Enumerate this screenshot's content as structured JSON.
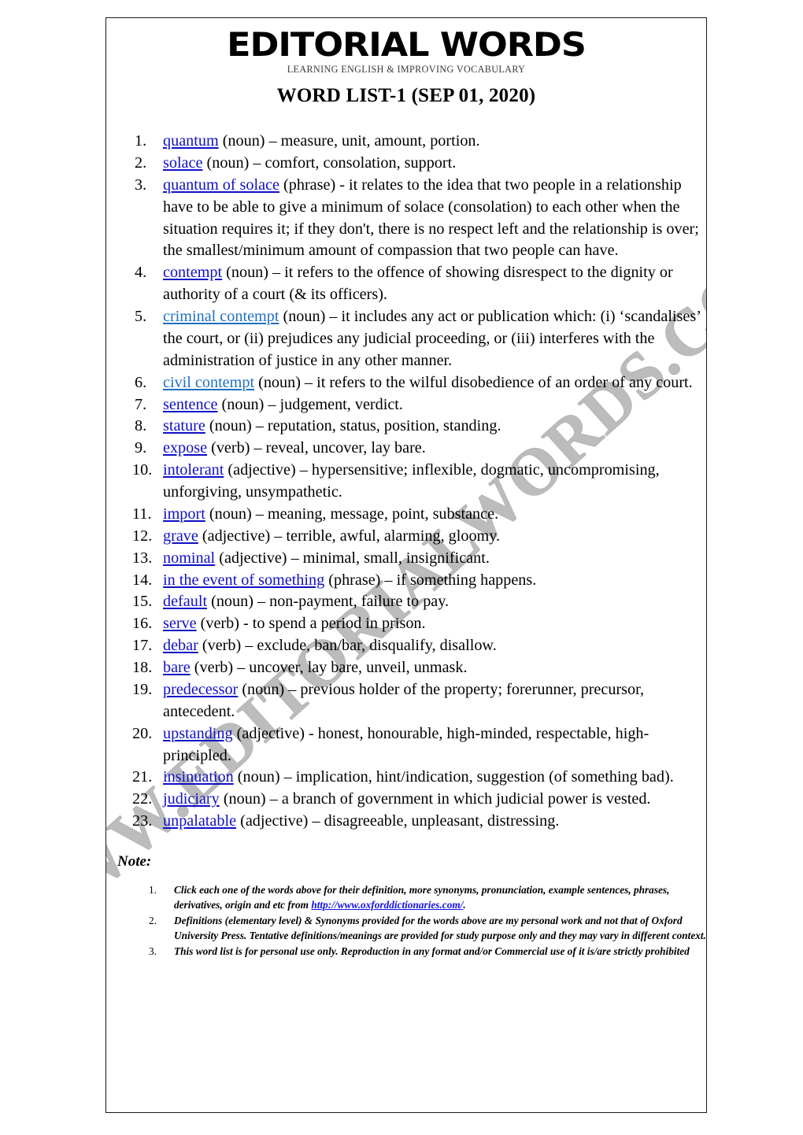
{
  "masthead": {
    "brand": "EDITORIAL WORDS",
    "tagline": "LEARNING ENGLISH & IMPROVING VOCABULARY",
    "title": "WORD LIST-1 (SEP 01, 2020)"
  },
  "watermark": {
    "text": "WWW.EDITORIALWORDS.COM",
    "color": "#b9b9b9"
  },
  "colors": {
    "link_dark_blue": "#1010c8",
    "link_light_blue": "#1f6fc0",
    "note_url_blue": "#1010ee",
    "text_black": "#000000",
    "border": "#1a1a1a"
  },
  "word_list": [
    {
      "num": "1.",
      "term": "quantum",
      "link_color": "dark",
      "rest": " (noun) – measure, unit, amount, portion."
    },
    {
      "num": "2.",
      "term": "solace",
      "link_color": "dark",
      "rest": " (noun) – comfort, consolation, support."
    },
    {
      "num": "3.",
      "term": "quantum of solace",
      "link_color": "dark",
      "rest": " (phrase) - it relates to the idea that two people in a relationship have to be able to give a minimum of solace (consolation) to each other when the situation requires it; if they don't, there is no respect left and the relationship is over; the smallest/minimum amount of compassion that two people can have."
    },
    {
      "num": "4.",
      "term": "contempt",
      "link_color": "dark",
      "rest": " (noun) – it refers to the offence of showing disrespect to the dignity or authority of a court (& its officers)."
    },
    {
      "num": "5.",
      "term": "criminal contempt",
      "link_color": "light",
      "rest": " (noun) – it includes any act or publication which: (i) ‘scandalises’ the court, or (ii) prejudices any judicial proceeding, or (iii) interferes with the administration of justice in any other manner."
    },
    {
      "num": "6.",
      "term": "civil contempt",
      "link_color": "light",
      "rest": " (noun) – it refers to the wilful disobedience of an order of any court."
    },
    {
      "num": "7.",
      "term": "sentence",
      "link_color": "dark",
      "rest": " (noun) – judgement, verdict."
    },
    {
      "num": "8.",
      "term": "stature",
      "link_color": "dark",
      "rest": " (noun) – reputation, status, position, standing."
    },
    {
      "num": "9.",
      "term": "expose",
      "link_color": "dark",
      "rest": " (verb) – reveal, uncover, lay bare."
    },
    {
      "num": "10.",
      "term": "intolerant",
      "link_color": "dark",
      "rest": " (adjective) – hypersensitive; inflexible, dogmatic, uncompromising, unforgiving, unsympathetic."
    },
    {
      "num": "11.",
      "term": "import",
      "link_color": "dark",
      "rest": " (noun) – meaning, message, point, substance."
    },
    {
      "num": "12.",
      "term": "grave",
      "link_color": "dark",
      "rest": " (adjective) – terrible, awful, alarming, gloomy."
    },
    {
      "num": "13.",
      "term": "nominal",
      "link_color": "dark",
      "rest": " (adjective) – minimal, small, insignificant."
    },
    {
      "num": "14.",
      "term": "in the event of something",
      "link_color": "dark",
      "rest": " (phrase) – if something happens."
    },
    {
      "num": "15.",
      "term": "default",
      "link_color": "dark",
      "rest": " (noun) – non-payment, failure to pay."
    },
    {
      "num": "16.",
      "term": "serve",
      "link_color": "dark",
      "rest": " (verb) - to spend a period in prison."
    },
    {
      "num": "17.",
      "term": "debar",
      "link_color": "dark",
      "rest": " (verb) – exclude, ban/bar, disqualify, disallow."
    },
    {
      "num": "18.",
      "term": "bare",
      "link_color": "dark",
      "rest": " (verb) – uncover, lay bare, unveil, unmask."
    },
    {
      "num": "19.",
      "term": "predecessor",
      "link_color": "dark",
      "rest": " (noun) – previous holder of the property; forerunner, precursor, antecedent."
    },
    {
      "num": "20.",
      "term": "upstanding",
      "link_color": "dark",
      "rest": " (adjective) - honest, honourable, high-minded, respectable, high-principled."
    },
    {
      "num": "21.",
      "term": "insinuation",
      "link_color": "dark",
      "rest": " (noun) – implication, hint/indication, suggestion (of something bad)."
    },
    {
      "num": "22.",
      "term": "judiciary",
      "link_color": "dark",
      "rest": " (noun) – a branch of government in which judicial power is vested."
    },
    {
      "num": "23.",
      "term": "unpalatable",
      "link_color": "dark",
      "rest": " (adjective) – disagreeable, unpleasant, distressing."
    }
  ],
  "note": {
    "label": "Note:",
    "items": [
      {
        "num": "1.",
        "text_before": "Click each one of the words above for their definition, more synonyms, pronunciation, example sentences, phrases, derivatives, origin and etc from ",
        "url": "http://www.oxforddictionaries.com/",
        "text_after": "."
      },
      {
        "num": "2.",
        "text_before": "Definitions (elementary level) & Synonyms provided for the words above are my personal work and not that of Oxford University Press. Tentative definitions/meanings are provided for study purpose only and they may vary in different context.",
        "url": "",
        "text_after": ""
      },
      {
        "num": "3.",
        "text_before": "This word list is for personal use only. Reproduction in any format and/or Commercial use of it is/are strictly prohibited",
        "url": "",
        "text_after": ""
      }
    ]
  }
}
